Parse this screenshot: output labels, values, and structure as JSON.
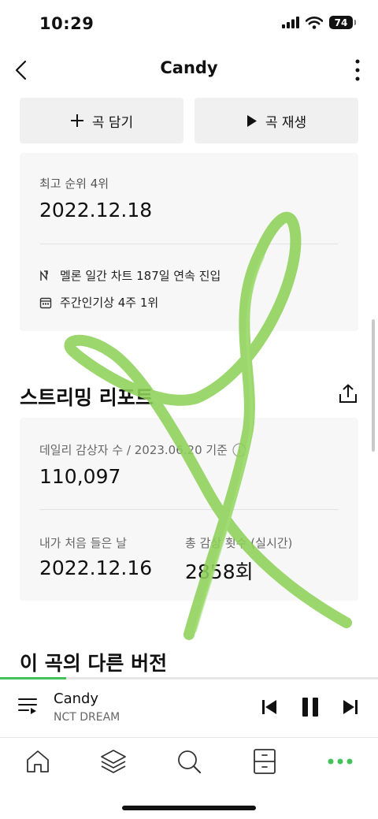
{
  "status_bar": {
    "time": "10:29",
    "battery": "74"
  },
  "header": {
    "title": "Candy"
  },
  "actions": {
    "add_label": "곡 담기",
    "play_label": "곡 재생"
  },
  "chart_info": {
    "best_rank_label": "최고 순위 4위",
    "best_rank_date": "2022.12.18",
    "daily_chart_text": "멜론 일간 차트 187일 연속 진입",
    "weekly_popular_text": "주간인기상 4주 1위"
  },
  "streaming_report": {
    "title": "스트리밍 리포트",
    "daily_listeners_label": "데일리 감상자 수 / 2023.06.20 기준",
    "daily_listeners_value": "110,097",
    "first_listen_label": "내가 처음 들은 날",
    "first_listen_date": "2022.12.16",
    "total_plays_label": "총 감상 횟수 (실시간)",
    "total_plays_value": "2858회"
  },
  "other_versions": {
    "title": "이 곡의 다른 버전"
  },
  "player": {
    "title": "Candy",
    "artist": "NCT DREAM",
    "progress": 0.175
  },
  "colors": {
    "accent": "#44c15a",
    "highlighter": "#8dd159"
  },
  "icons": {
    "nav": [
      "home-icon",
      "layers-icon",
      "search-icon",
      "library-icon",
      "more-dots-icon"
    ]
  }
}
